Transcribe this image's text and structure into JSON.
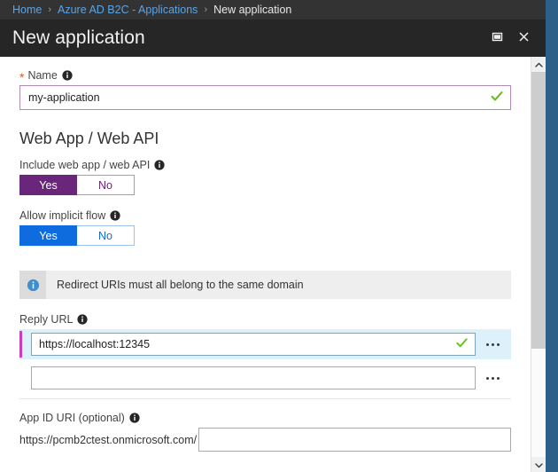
{
  "breadcrumb": {
    "items": [
      {
        "label": "Home",
        "current": false
      },
      {
        "label": "Azure AD B2C - Applications",
        "current": false
      },
      {
        "label": "New application",
        "current": true
      }
    ],
    "separator": "›"
  },
  "titlebar": {
    "title": "New application",
    "maximize_icon": "maximize-icon",
    "close_icon": "close-icon"
  },
  "form": {
    "name": {
      "label": "Name",
      "required_marker": "*",
      "info_icon": "info-icon",
      "value": "my-application",
      "placeholder": "",
      "valid_icon": "checkmark-icon"
    },
    "web_section": {
      "heading": "Web App / Web API",
      "include_toggle": {
        "label": "Include web app / web API",
        "info_icon": "info-icon",
        "options": [
          "Yes",
          "No"
        ],
        "selected": "Yes",
        "accent_color": "#69267a"
      },
      "implicit_toggle": {
        "label": "Allow implicit flow",
        "info_icon": "info-icon",
        "options": [
          "Yes",
          "No"
        ],
        "selected": "Yes",
        "accent_color": "#0f6cde"
      }
    },
    "info_banner": {
      "icon": "info-circle-icon",
      "text": "Redirect URIs must all belong to the same domain"
    },
    "reply_url": {
      "label": "Reply URL",
      "info_icon": "info-icon",
      "rows": [
        {
          "value": "https://localhost:12345",
          "placeholder": "",
          "active": true,
          "valid_icon": "checkmark-icon",
          "menu_icon": "ellipsis-icon"
        },
        {
          "value": "",
          "placeholder": "",
          "active": false,
          "valid_icon": "",
          "menu_icon": "ellipsis-icon"
        }
      ]
    },
    "app_id_uri": {
      "label": "App ID URI (optional)",
      "info_icon": "info-icon",
      "prefix": "https://pcmb2ctest.onmicrosoft.com/",
      "value": "",
      "placeholder": ""
    }
  },
  "scrollbar": {
    "up_icon": "chevron-up-icon",
    "down_icon": "chevron-down-icon"
  },
  "colors": {
    "breadcrumb_bg": "#333333",
    "titlebar_bg": "#262626",
    "link": "#5ba4e5",
    "purple": "#69267a",
    "blue": "#0f6cde",
    "green_check": "#6abf1f",
    "magenta_accent": "#cc3ec1",
    "required_star": "#d05a29",
    "right_edge": "#2d6089"
  }
}
